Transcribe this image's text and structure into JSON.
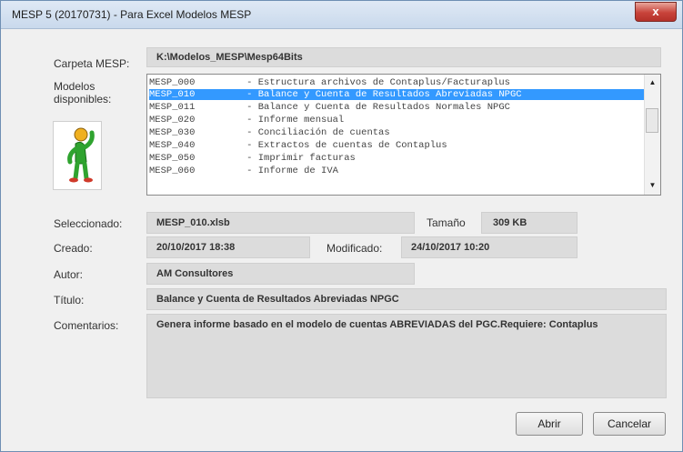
{
  "window": {
    "title": "MESP 5 (20170731) - Para Excel Modelos MESP",
    "close_label": "x"
  },
  "folder": {
    "label": "Carpeta MESP:",
    "value": "K:\\Modelos_MESP\\Mesp64Bits"
  },
  "models": {
    "label_line1": "Modelos",
    "label_line2": "disponibles:",
    "items": [
      "MESP_000         - Estructura archivos de Contaplus/Facturaplus",
      "MESP_010         - Balance y Cuenta de Resultados Abreviadas NPGC",
      "MESP_011         - Balance y Cuenta de Resultados Normales NPGC",
      "MESP_020         - Informe mensual",
      "MESP_030         - Conciliación de cuentas",
      "MESP_040         - Extractos de cuentas de Contaplus",
      "MESP_050         - Imprimir facturas",
      "MESP_060         - Informe de IVA"
    ],
    "selected_index": 1,
    "scroll_up_icon": "▲",
    "scroll_down_icon": "▼"
  },
  "details": {
    "selected_label": "Seleccionado:",
    "selected_value": "MESP_010.xlsb",
    "size_label": "Tamaño",
    "size_value": "309 KB",
    "created_label": "Creado:",
    "created_value": "20/10/2017 18:38",
    "modified_label": "Modificado:",
    "modified_value": "24/10/2017 10:20",
    "author_label": "Autor:",
    "author_value": "AM Consultores",
    "title_label": "Título:",
    "title_value": "Balance y Cuenta de Resultados Abreviadas NPGC",
    "comments_label": "Comentarios:",
    "comments_value": "Genera informe basado en el modelo de cuentas ABREVIADAS del PGC.Requiere: Contaplus"
  },
  "buttons": {
    "open": "Abrir",
    "cancel": "Cancelar"
  },
  "colors": {
    "selection": "#3399ff",
    "close_button": "#c8433a"
  }
}
